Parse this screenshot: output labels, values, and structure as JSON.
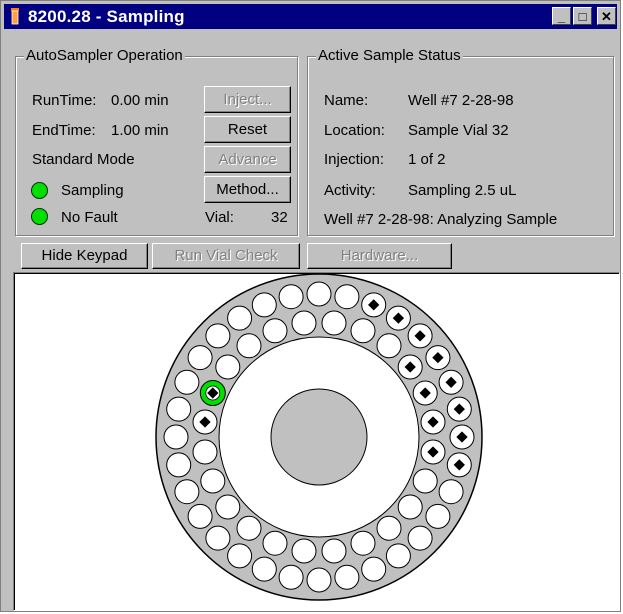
{
  "window": {
    "title": "8200.28 - Sampling",
    "controls": {
      "minimize": "_",
      "maximize": "□",
      "close": "✕"
    }
  },
  "autosampler": {
    "group_title": "AutoSampler Operation",
    "runtime_label": "RunTime:",
    "runtime_value": "0.00 min",
    "endtime_label": "EndTime:",
    "endtime_value": "1.00 min",
    "mode": "Standard Mode",
    "status1": "Sampling",
    "status2": "No Fault",
    "vial_label": "Vial:",
    "vial_value": "32",
    "buttons": {
      "inject": "Inject...",
      "reset": "Reset",
      "advance": "Advance",
      "method": "Method..."
    }
  },
  "status": {
    "group_title": "Active Sample Status",
    "name_label": "Name:",
    "name_value": "Well #7 2-28-98",
    "location_label": "Location:",
    "location_value": "Sample Vial 32",
    "injection_label": "Injection:",
    "injection_value": "1 of 2",
    "activity_label": "Activity:",
    "activity_value": "Sampling 2.5 uL",
    "message": "Well #7 2-28-98: Analyzing Sample"
  },
  "toolbar": {
    "hide_keypad": "Hide Keypad",
    "run_vial_check": "Run Vial Check",
    "hardware": "Hardware..."
  },
  "tray": {
    "colors": {
      "tray": "#c0c0c0",
      "empty": "#ffffff",
      "filled_dot": "#000000",
      "active": "#00e000"
    },
    "outer_ring": {
      "count": 32,
      "filled": [
        2,
        3,
        4,
        5,
        6,
        7,
        8,
        9
      ],
      "active": null
    },
    "inner_ring": {
      "count": 24,
      "filled": [
        3,
        4,
        5,
        6,
        18,
        19
      ],
      "active": 19
    }
  }
}
